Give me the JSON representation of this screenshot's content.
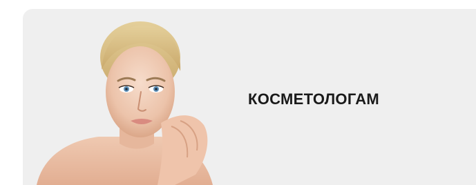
{
  "card": {
    "title": "КОСМЕТОЛОГАМ",
    "image_subject": "woman-portrait"
  },
  "colors": {
    "card_background": "#efefef",
    "title_text": "#1a1a1a"
  }
}
